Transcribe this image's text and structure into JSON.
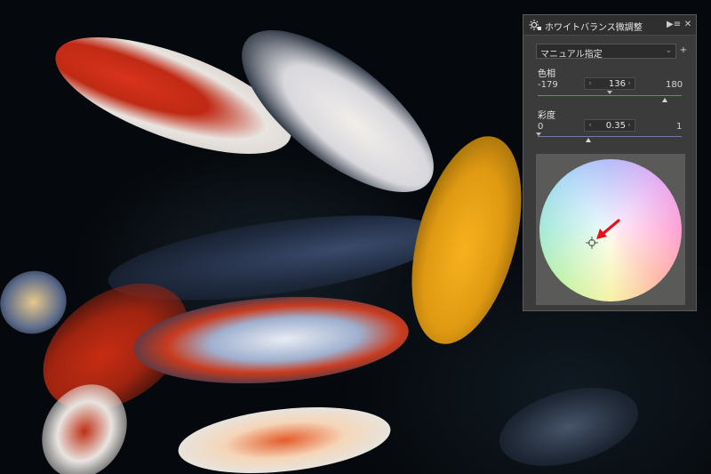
{
  "panel": {
    "title": "ホワイトバランス微調整",
    "title_icon": "sun-adjust-icon",
    "menu_icon": "panel-menu-icon",
    "close_icon": "close-icon",
    "preset": {
      "value": "マニュアル指定"
    },
    "add_preset_icon": "+",
    "hue": {
      "label": "色相",
      "min": "-179",
      "max": "180",
      "value": "136",
      "value_fraction": 0.88
    },
    "saturation": {
      "label": "彩度",
      "min": "0",
      "max": "1",
      "value": "0.35",
      "value_fraction": 0.35
    },
    "color_wheel": {
      "marker_icon": "crosshair-icon",
      "annotation_icon": "red-arrow-icon",
      "annotation_color": "#e8101a"
    }
  },
  "colors": {
    "panel_bg": "#3b3b3b",
    "slider_track": "#6a7fa8"
  }
}
